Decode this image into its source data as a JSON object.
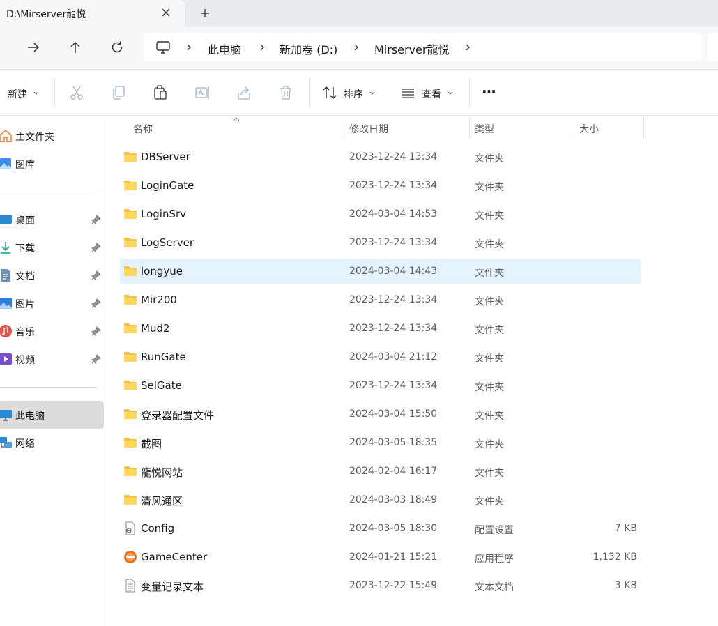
{
  "window": {
    "tab_title": "D:\\Mirserver龍悦"
  },
  "address": {
    "breadcrumbs": [
      "此电脑",
      "新加卷 (D:)",
      "Mirserver龍悦"
    ]
  },
  "toolbar": {
    "new_label": "新建",
    "sort_label": "排序",
    "view_label": "查看",
    "more_label": "···"
  },
  "sidebar": {
    "home": "主文件夹",
    "gallery": "图库",
    "pinned": [
      "桌面",
      "下载",
      "文档",
      "图片",
      "音乐",
      "视频"
    ],
    "this_pc": "此电脑",
    "network": "网络"
  },
  "columns": {
    "name": "名称",
    "date": "修改日期",
    "type": "类型",
    "size": "大小"
  },
  "files": [
    {
      "name": "DBServer",
      "date": "2023-12-24 13:34",
      "type": "文件夹",
      "size": ""
    },
    {
      "name": "LoginGate",
      "date": "2023-12-24 13:34",
      "type": "文件夹",
      "size": ""
    },
    {
      "name": "LoginSrv",
      "date": "2024-03-04 14:53",
      "type": "文件夹",
      "size": ""
    },
    {
      "name": "LogServer",
      "date": "2023-12-24 13:34",
      "type": "文件夹",
      "size": ""
    },
    {
      "name": "longyue",
      "date": "2024-03-04 14:43",
      "type": "文件夹",
      "size": ""
    },
    {
      "name": "Mir200",
      "date": "2023-12-24 13:34",
      "type": "文件夹",
      "size": ""
    },
    {
      "name": "Mud2",
      "date": "2023-12-24 13:34",
      "type": "文件夹",
      "size": ""
    },
    {
      "name": "RunGate",
      "date": "2024-03-04 21:12",
      "type": "文件夹",
      "size": ""
    },
    {
      "name": "SelGate",
      "date": "2023-12-24 13:34",
      "type": "文件夹",
      "size": ""
    },
    {
      "name": "登录器配置文件",
      "date": "2024-03-04 15:50",
      "type": "文件夹",
      "size": ""
    },
    {
      "name": "截图",
      "date": "2024-03-05 18:35",
      "type": "文件夹",
      "size": ""
    },
    {
      "name": "龍悦网站",
      "date": "2024-02-04 16:17",
      "type": "文件夹",
      "size": ""
    },
    {
      "name": "清风通区",
      "date": "2024-03-03 18:49",
      "type": "文件夹",
      "size": ""
    },
    {
      "name": "Config",
      "date": "2024-03-05 18:30",
      "type": "配置设置",
      "size": "7 KB"
    },
    {
      "name": "GameCenter",
      "date": "2024-01-21 15:21",
      "type": "应用程序",
      "size": "1,132 KB"
    },
    {
      "name": "变量记录文本",
      "date": "2023-12-22 15:49",
      "type": "文本文档",
      "size": "3 KB"
    }
  ],
  "icons": {
    "folder": "folder-icon",
    "config": "settings-file-icon",
    "app": "gamecenter-app-icon",
    "text": "text-file-icon"
  },
  "colors": {
    "selected_row": "#e5f3fd",
    "folder": "#f5c342",
    "accent": "#0067c0"
  }
}
